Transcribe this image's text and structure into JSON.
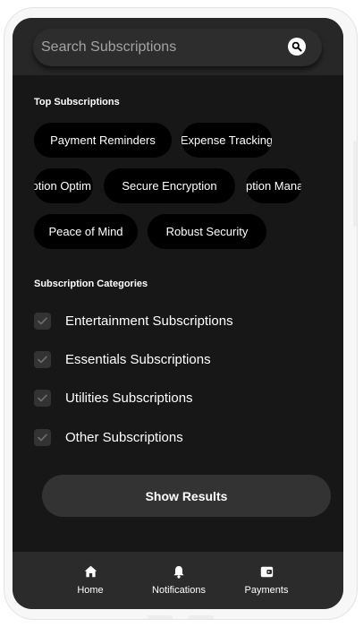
{
  "search": {
    "placeholder": "Search Subscriptions"
  },
  "top_section": {
    "title": "Top Subscriptions",
    "chips": [
      "Payment Reminders",
      "Expense Tracking",
      "ption Optim",
      "Secure Encryption",
      "ption Mana",
      "Peace of Mind",
      "Robust Security"
    ]
  },
  "categories_section": {
    "title": "Subscription Categories",
    "items": [
      {
        "label": "Entertainment Subscriptions",
        "checked": true
      },
      {
        "label": "Essentials Subscriptions",
        "checked": true
      },
      {
        "label": "Utilities Subscriptions",
        "checked": true
      },
      {
        "label": "Other Subscriptions",
        "checked": true
      }
    ]
  },
  "show_results_label": "Show Results",
  "nav": {
    "items": [
      {
        "label": "Home",
        "icon": "home-icon"
      },
      {
        "label": "Notifications",
        "icon": "bell-icon"
      },
      {
        "label": "Payments",
        "icon": "wallet-icon"
      }
    ]
  },
  "colors": {
    "screen_bg": "#171717",
    "header_bg": "#272727",
    "chip_bg": "#000000",
    "button_bg": "#333333",
    "nav_bg": "#2b2b2b",
    "text": "#ffffff",
    "placeholder": "#a3a3a3"
  }
}
